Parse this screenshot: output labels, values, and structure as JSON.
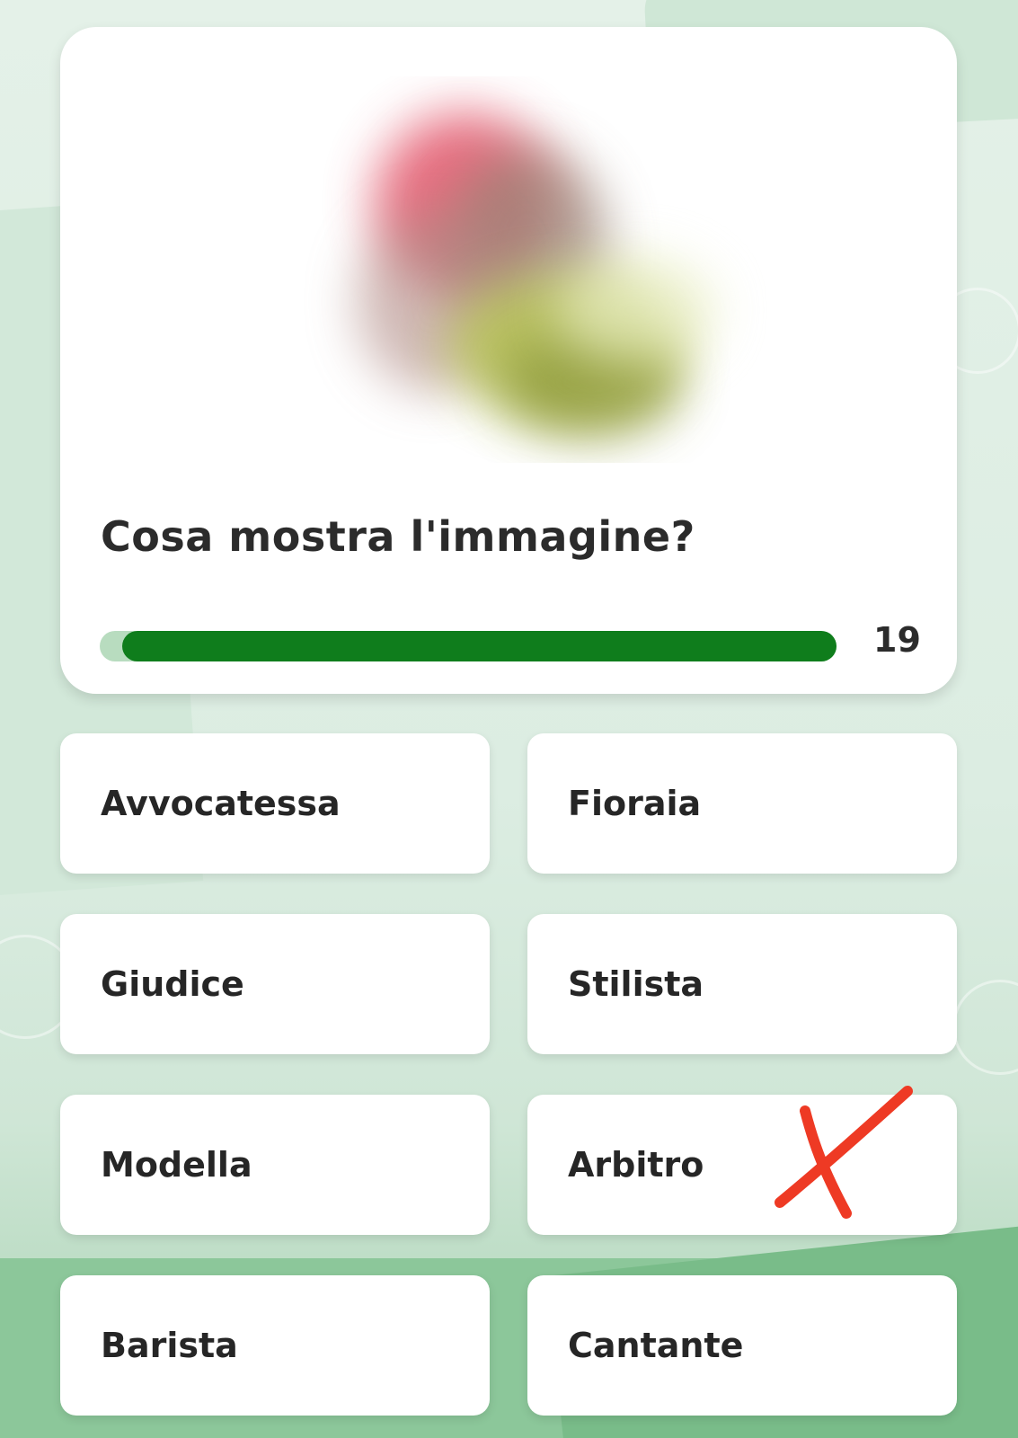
{
  "question": {
    "text": "Cosa mostra l'immagine?",
    "image_icon": "blurred-photo",
    "timer": {
      "seconds_left": "19",
      "fraction_remaining": 0.97
    }
  },
  "answers": [
    {
      "label": "Avvocatessa"
    },
    {
      "label": "Fioraia"
    },
    {
      "label": "Giudice"
    },
    {
      "label": "Stilista"
    },
    {
      "label": "Modella"
    },
    {
      "label": "Arbitro",
      "marked": "wrong-cross-icon"
    },
    {
      "label": "Barista"
    },
    {
      "label": "Cantante"
    }
  ],
  "colors": {
    "accent_green": "#0f7d1c",
    "track_green": "#b8dcbf",
    "cross_red": "#ee3a24"
  }
}
